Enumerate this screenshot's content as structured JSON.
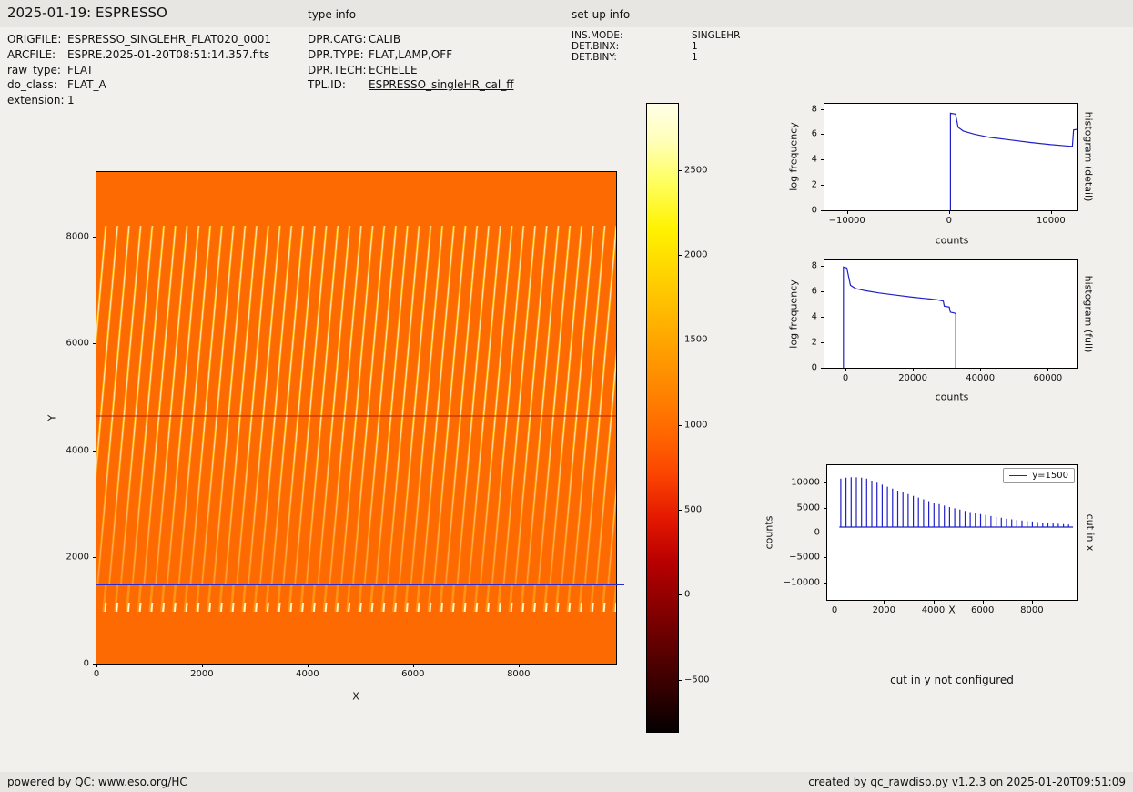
{
  "header": {
    "title": "2025-01-19: ESPRESSO",
    "type_info_label": "type info",
    "setup_info_label": "set-up info"
  },
  "metadata": {
    "file": [
      {
        "label": "ORIGFILE:",
        "value": "ESPRESSO_SINGLEHR_FLAT020_0001"
      },
      {
        "label": "ARCFILE:",
        "value": "ESPRE.2025-01-20T08:51:14.357.fits"
      },
      {
        "label": "raw_type:",
        "value": "FLAT"
      },
      {
        "label": "do_class:",
        "value": "FLAT_A"
      },
      {
        "label": "extension:",
        "value": "1"
      }
    ],
    "type": [
      {
        "label": "DPR.CATG:",
        "value": "CALIB"
      },
      {
        "label": "DPR.TYPE:",
        "value": "FLAT,LAMP,OFF"
      },
      {
        "label": "DPR.TECH:",
        "value": "ECHELLE"
      },
      {
        "label": "TPL.ID:",
        "value": "ESPRESSO_singleHR_cal_ff"
      }
    ],
    "setup": [
      {
        "label": "INS.MODE:",
        "value": "SINGLEHR"
      },
      {
        "label": "DET.BINX:",
        "value": "1"
      },
      {
        "label": "DET.BINY:",
        "value": "1"
      }
    ]
  },
  "notes": {
    "cut_y": "cut in y not configured"
  },
  "footer": {
    "left": "powered by QC: www.eso.org/HC",
    "right": "created by qc_rawdisp.py v1.2.3 on 2025-01-20T09:51:09"
  },
  "chart_data": [
    {
      "id": "raw_frame",
      "type": "heatmap",
      "title": "",
      "xlabel": "X",
      "ylabel": "Y",
      "xlim": [
        0,
        9850
      ],
      "ylim": [
        0,
        9215
      ],
      "xticks": [
        0,
        2000,
        4000,
        6000,
        8000
      ],
      "yticks": [
        0,
        2000,
        4000,
        6000,
        8000
      ],
      "description": "Raw ESPRESSO flat-field frame: uniform orange background (~1000-1200 counts) with ~45 slightly slanted bright echelle-order stripes between y~1500 and y~8200, fading toward lower rows; short bright order dashes near y~1000; thin darker row near y~4650; horizontal blue cut line at y=1500.",
      "cut_line_y": 1500,
      "dark_row_y": 4650,
      "n_order_stripes": 45,
      "colormap": "hot"
    },
    {
      "id": "colorbar",
      "type": "colorbar",
      "ylim": [
        -807,
        2890
      ],
      "yticks": [
        -500,
        0,
        500,
        1000,
        1500,
        2000,
        2500
      ],
      "ticks_right": true,
      "colormap": "hot (black to red to orange to yellow to white)"
    },
    {
      "id": "hist_detail",
      "type": "line",
      "xlabel": "counts",
      "ylabel": "log frequency",
      "right_label": "histogram (detail)",
      "xlim": [
        -12200,
        12600
      ],
      "ylim": [
        0,
        8.4
      ],
      "xticks": [
        -10000,
        0,
        10000
      ],
      "yticks": [
        0,
        2,
        4,
        6,
        8
      ],
      "color": "#2020c8",
      "x": [
        150,
        150,
        650,
        900,
        1400,
        2500,
        4000,
        6000,
        8000,
        10000,
        11400,
        12100,
        12220,
        12550
      ],
      "y": [
        0,
        7.65,
        7.58,
        6.55,
        6.25,
        6.0,
        5.75,
        5.55,
        5.35,
        5.18,
        5.08,
        5.04,
        6.35,
        6.38
      ]
    },
    {
      "id": "hist_full",
      "type": "line",
      "xlabel": "counts",
      "ylabel": "log frequency",
      "right_label": "histogram (full)",
      "xlim": [
        -6200,
        68800
      ],
      "ylim": [
        0,
        8.4
      ],
      "xticks": [
        0,
        20000,
        40000,
        60000
      ],
      "yticks": [
        0,
        2,
        4,
        6,
        8
      ],
      "color": "#2020c8",
      "x": [
        -600,
        -600,
        400,
        1500,
        3000,
        6000,
        10000,
        15000,
        20000,
        25000,
        27500,
        29000,
        29300,
        30800,
        31100,
        32400,
        32700,
        32700
      ],
      "y": [
        0,
        7.88,
        7.8,
        6.45,
        6.2,
        6.02,
        5.85,
        5.68,
        5.52,
        5.38,
        5.3,
        5.22,
        4.82,
        4.75,
        4.35,
        4.28,
        4.22,
        0
      ]
    },
    {
      "id": "cut_x",
      "type": "stem",
      "xlabel": "X",
      "ylabel": "counts",
      "right_label": "cut in x",
      "legend_label": "y=1500",
      "xlim": [
        -300,
        9850
      ],
      "ylim": [
        -13500,
        13500
      ],
      "xticks": [
        0,
        2000,
        4000,
        6000,
        8000
      ],
      "yticks": [
        -10000,
        -5000,
        0,
        5000,
        10000
      ],
      "color": "#2020c8",
      "baseline": 1100,
      "stems": [
        [
          250,
          10800
        ],
        [
          460,
          11000
        ],
        [
          670,
          11100
        ],
        [
          880,
          11050
        ],
        [
          1090,
          11000
        ],
        [
          1300,
          10800
        ],
        [
          1510,
          10400
        ],
        [
          1720,
          10000
        ],
        [
          1930,
          9600
        ],
        [
          2140,
          9200
        ],
        [
          2350,
          8800
        ],
        [
          2560,
          8400
        ],
        [
          2770,
          8050
        ],
        [
          2980,
          7700
        ],
        [
          3190,
          7350
        ],
        [
          3400,
          7000
        ],
        [
          3610,
          6650
        ],
        [
          3820,
          6300
        ],
        [
          4030,
          6000
        ],
        [
          4240,
          5700
        ],
        [
          4450,
          5400
        ],
        [
          4660,
          5100
        ],
        [
          4870,
          4850
        ],
        [
          5080,
          4600
        ],
        [
          5290,
          4350
        ],
        [
          5500,
          4100
        ],
        [
          5710,
          3900
        ],
        [
          5920,
          3700
        ],
        [
          6130,
          3500
        ],
        [
          6340,
          3300
        ],
        [
          6550,
          3100
        ],
        [
          6760,
          2950
        ],
        [
          6970,
          2800
        ],
        [
          7180,
          2650
        ],
        [
          7390,
          2500
        ],
        [
          7600,
          2400
        ],
        [
          7810,
          2300
        ],
        [
          8020,
          2200
        ],
        [
          8230,
          2100
        ],
        [
          8440,
          2000
        ],
        [
          8650,
          1900
        ],
        [
          8860,
          1820
        ],
        [
          9070,
          1750
        ],
        [
          9280,
          1680
        ],
        [
          9490,
          1620
        ]
      ]
    }
  ]
}
